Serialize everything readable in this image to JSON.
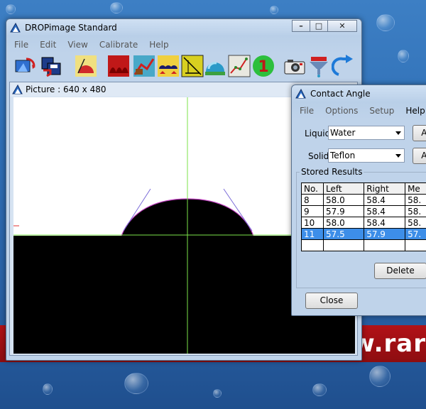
{
  "main_window": {
    "title": "DROPimage Standard",
    "menu": [
      "File",
      "Edit",
      "View",
      "Calibrate",
      "Help"
    ],
    "caption_buttons": [
      "minimize",
      "maximize",
      "close"
    ],
    "toolbar_icons": [
      "open-picture-icon",
      "save-picture-icon",
      "angle-fit-icon",
      "pendant-drop-icon",
      "surface-check-icon",
      "multi-drop-icon",
      "tilt-icon",
      "sessile-drop-icon",
      "graph-icon",
      "one-icon",
      "camera-icon",
      "dispense-icon",
      "redo-icon"
    ]
  },
  "picture_window": {
    "title": "Picture : 640 x 480"
  },
  "contact_window": {
    "title": "Contact Angle",
    "menu": [
      "File",
      "Options",
      "Setup",
      "Help"
    ],
    "liquid_label": "Liquid:",
    "liquid_value": "Water",
    "solid_label": "Solid:",
    "solid_value": "Teflon",
    "add_label": "Ad",
    "stored_results_label": "Stored Results",
    "table": {
      "headers": [
        "No.",
        "Left",
        "Right",
        "Me"
      ],
      "rows": [
        [
          "8",
          "58.0",
          "58.4",
          "58."
        ],
        [
          "9",
          "57.9",
          "58.4",
          "58."
        ],
        [
          "10",
          "58.0",
          "58.4",
          "58."
        ],
        [
          "11",
          "57.5",
          "57.9",
          "57."
        ],
        [
          "",
          "",
          "",
          ""
        ]
      ],
      "selected_row": 3
    },
    "delete_label": "Delete",
    "close_label": "Close"
  },
  "desktop": {
    "banner_text": "w.rar"
  },
  "colors": {
    "selection": "#3d8ee8",
    "banner": "#b21217",
    "crosshair": "#7be34a",
    "drop_outline": "#c040c0"
  }
}
